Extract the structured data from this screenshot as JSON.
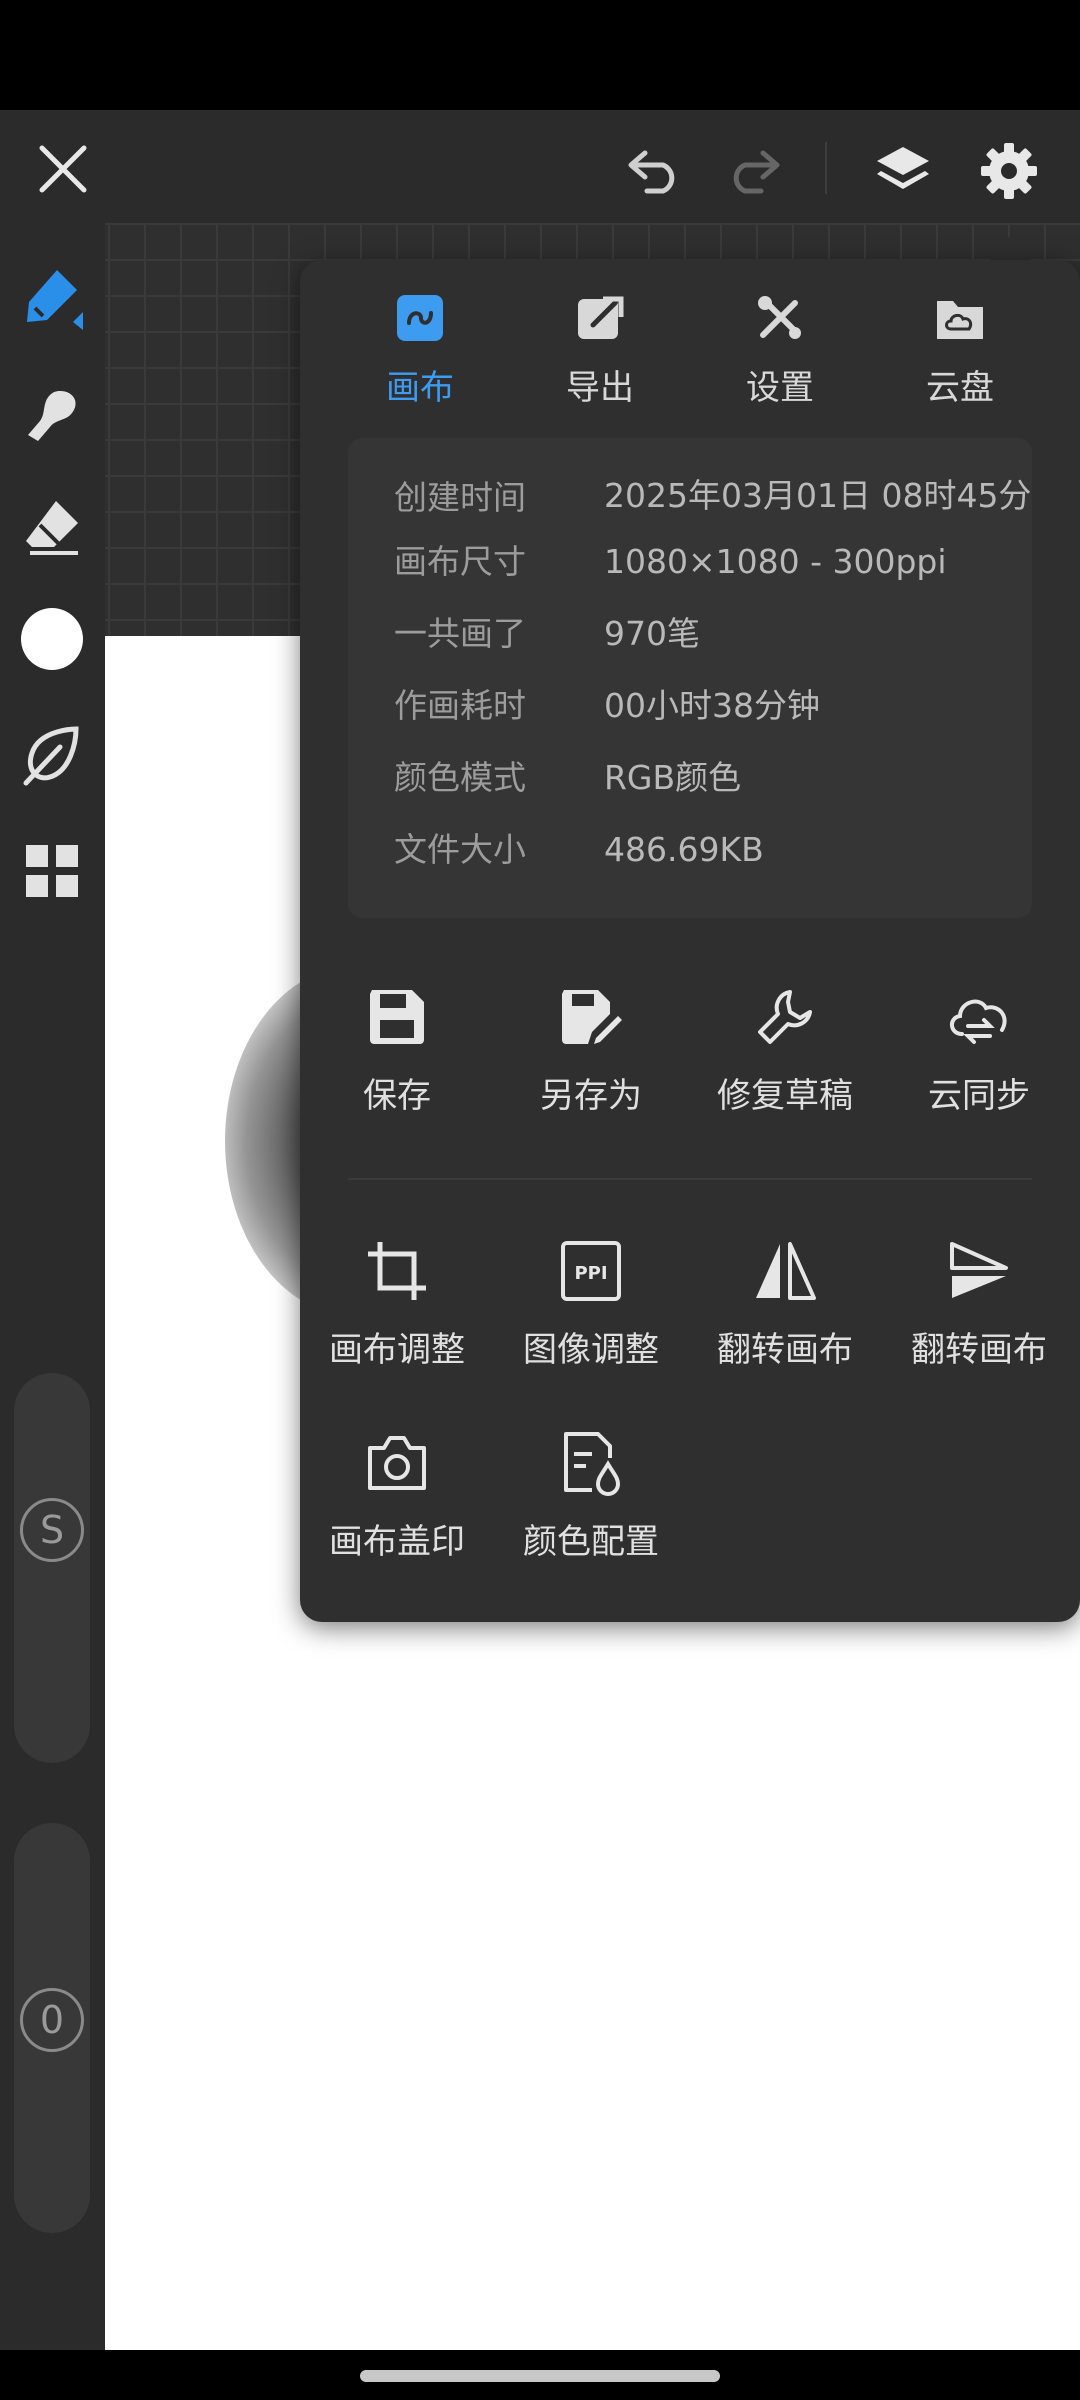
{
  "toolbar": {
    "close": "close",
    "undo": "undo",
    "redo": "redo",
    "layers": "layers",
    "settings": "settings"
  },
  "tabs": [
    {
      "label": "画布",
      "icon": "canvas-icon",
      "active": true
    },
    {
      "label": "导出",
      "icon": "export-icon",
      "active": false
    },
    {
      "label": "设置",
      "icon": "settings-tools-icon",
      "active": false
    },
    {
      "label": "云盘",
      "icon": "cloud-drive-icon",
      "active": false
    }
  ],
  "info": [
    {
      "key": "创建时间",
      "value": "2025年03月01日 08时45分"
    },
    {
      "key": "画布尺寸",
      "value": "1080×1080 - 300ppi"
    },
    {
      "key": "一共画了",
      "value": "970笔"
    },
    {
      "key": "作画耗时",
      "value": "00小时38分钟"
    },
    {
      "key": "颜色模式",
      "value": "RGB颜色"
    },
    {
      "key": "文件大小",
      "value": "486.69KB"
    }
  ],
  "actions_row1": [
    {
      "label": "保存",
      "icon": "save-icon"
    },
    {
      "label": "另存为",
      "icon": "save-as-icon"
    },
    {
      "label": "修复草稿",
      "icon": "wrench-icon"
    },
    {
      "label": "云同步",
      "icon": "cloud-sync-icon"
    }
  ],
  "actions_row2": [
    {
      "label": "画布调整",
      "icon": "crop-icon"
    },
    {
      "label": "图像调整",
      "icon": "ppi-icon"
    },
    {
      "label": "翻转画布",
      "icon": "flip-horizontal-icon"
    },
    {
      "label": "翻转画布",
      "icon": "flip-vertical-icon"
    }
  ],
  "actions_row3": [
    {
      "label": "画布盖印",
      "icon": "camera-icon"
    },
    {
      "label": "颜色配置",
      "icon": "color-profile-icon"
    }
  ],
  "rail": {
    "size_slider_label": "S",
    "opacity_slider_label": "0"
  },
  "colors": {
    "accent": "#3d9bf0",
    "panel": "#2f2f2f",
    "toolbar": "#2b2b2b"
  }
}
